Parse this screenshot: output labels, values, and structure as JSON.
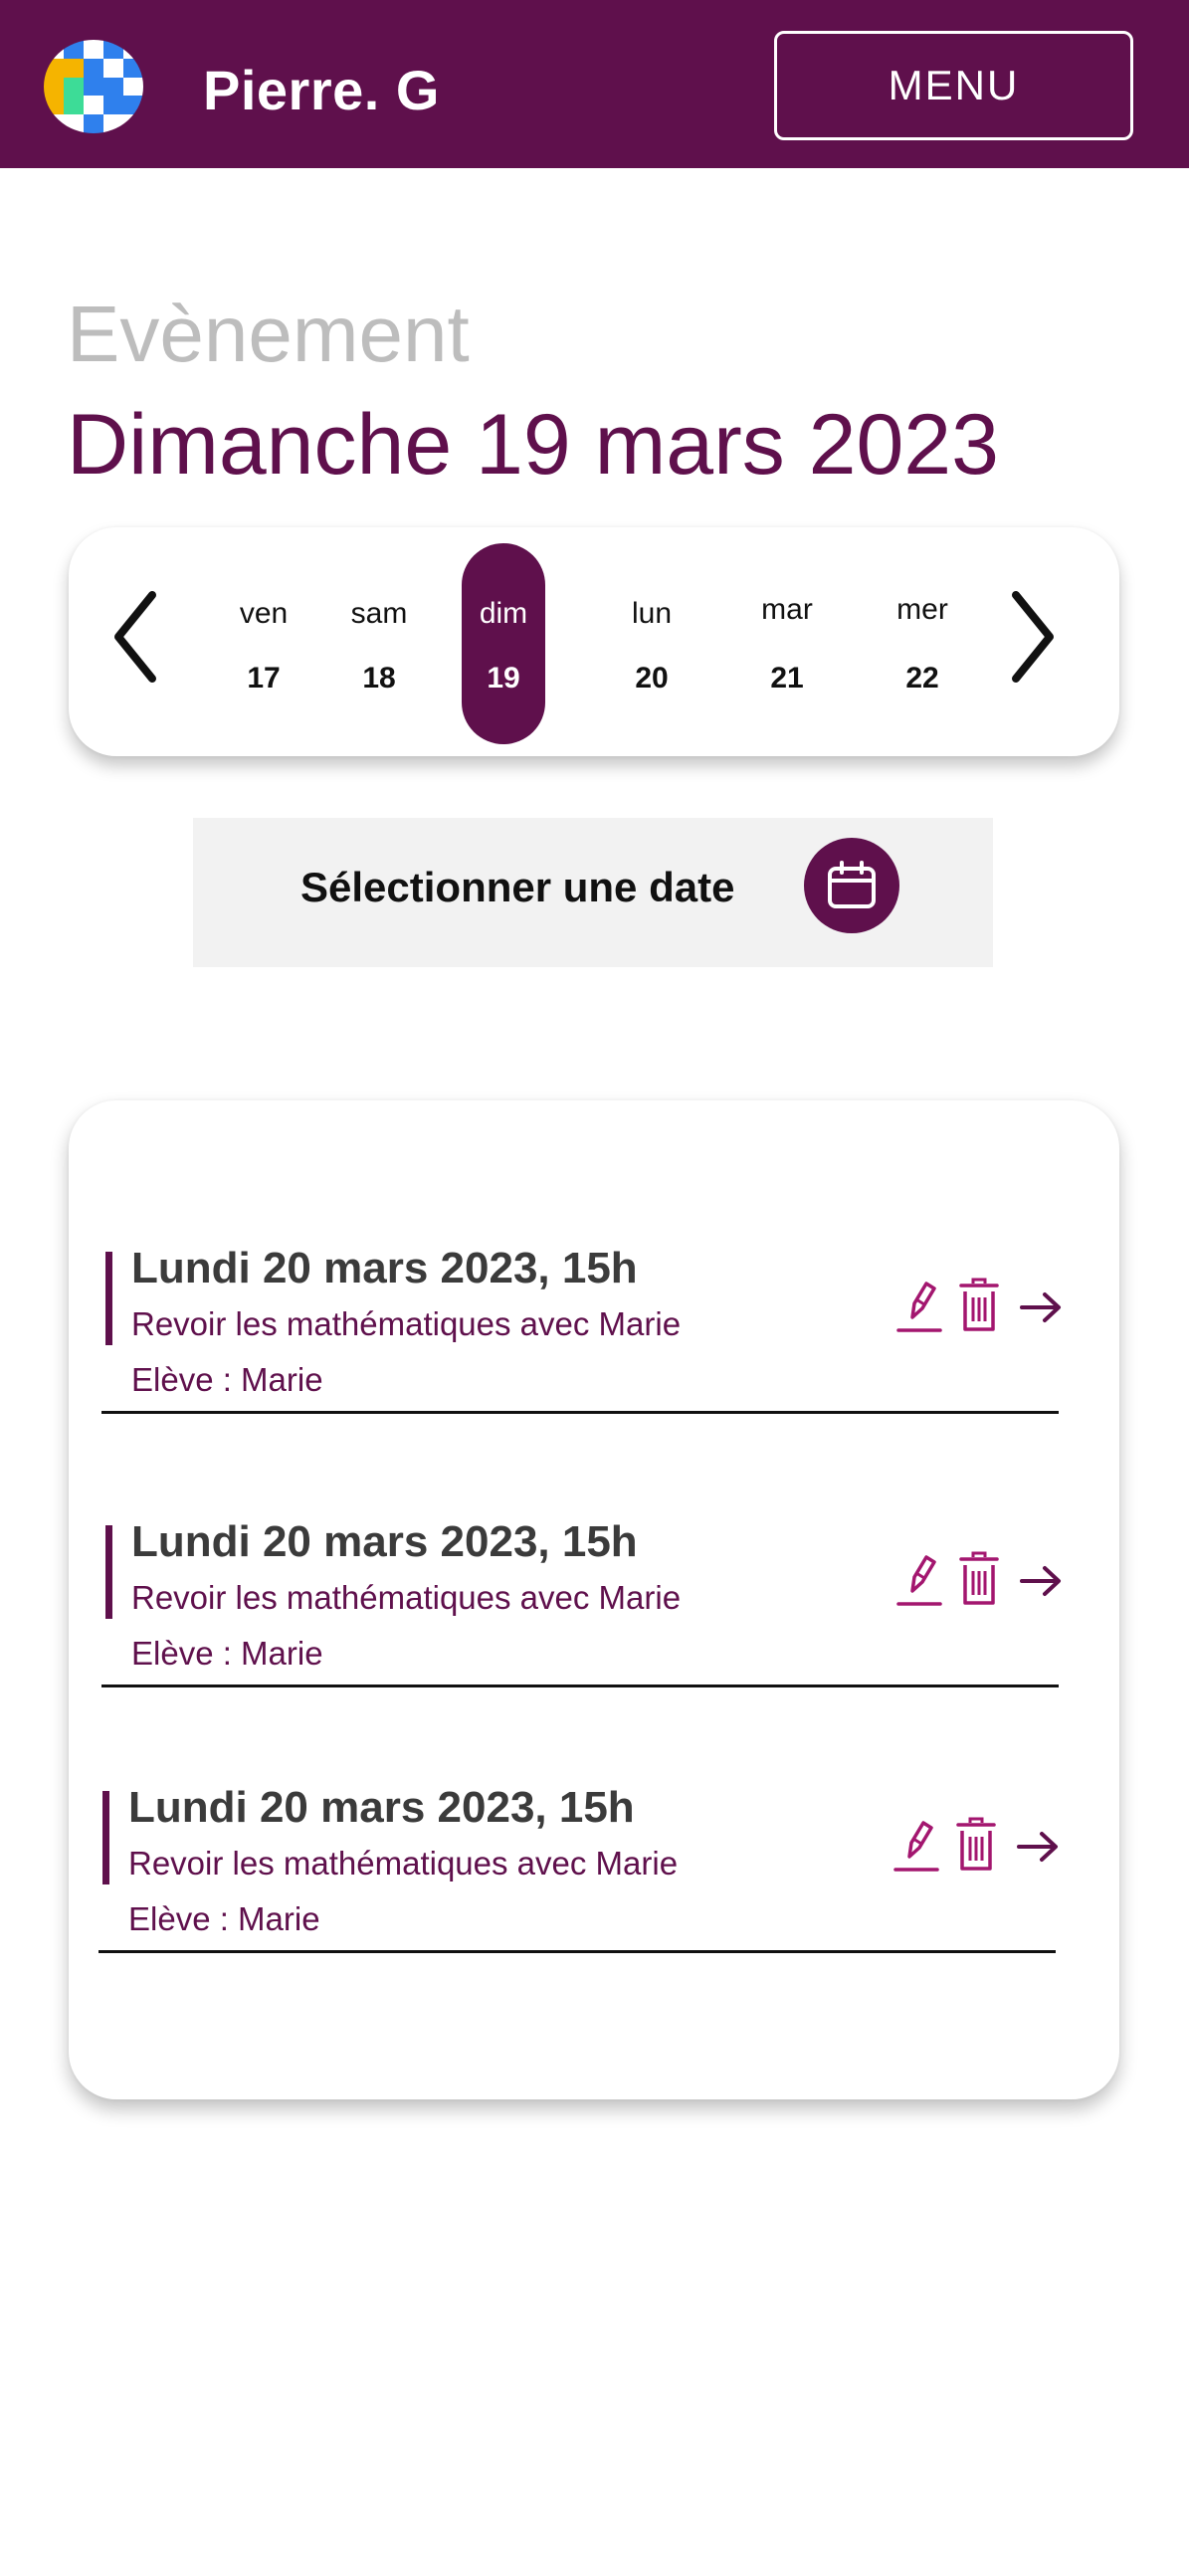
{
  "header": {
    "username": "Pierre. G",
    "menu_label": "MENU",
    "logo_colors": [
      "#2f80ed",
      "#f5b400",
      "#3ddc97",
      "#ffffff"
    ]
  },
  "page": {
    "kicker": "Evènement",
    "date_title": "Dimanche 19 mars 2023"
  },
  "week": {
    "days": [
      {
        "name": "ven",
        "num": "17"
      },
      {
        "name": "sam",
        "num": "18"
      },
      {
        "name": "dim",
        "num": "19",
        "selected": true
      },
      {
        "name": "lun",
        "num": "20"
      },
      {
        "name": "mar",
        "num": "21"
      },
      {
        "name": "mer",
        "num": "22"
      }
    ]
  },
  "select_date": {
    "label": "Sélectionner une date",
    "icon": "calendar-icon"
  },
  "events": [
    {
      "title": "Lundi 20 mars 2023, 15h",
      "description": "Revoir les mathématiques avec Marie",
      "student": "Elève : Marie"
    },
    {
      "title": "Lundi 20 mars 2023, 15h",
      "description": "Revoir les mathématiques avec Marie",
      "student": "Elève : Marie"
    },
    {
      "title": "Lundi 20 mars 2023, 15h",
      "description": "Revoir les mathématiques avec Marie",
      "student": "Elève : Marie"
    }
  ],
  "colors": {
    "brand": "#5f104c",
    "icon_accent": "#a3166f",
    "kicker": "#bdbdbd"
  }
}
